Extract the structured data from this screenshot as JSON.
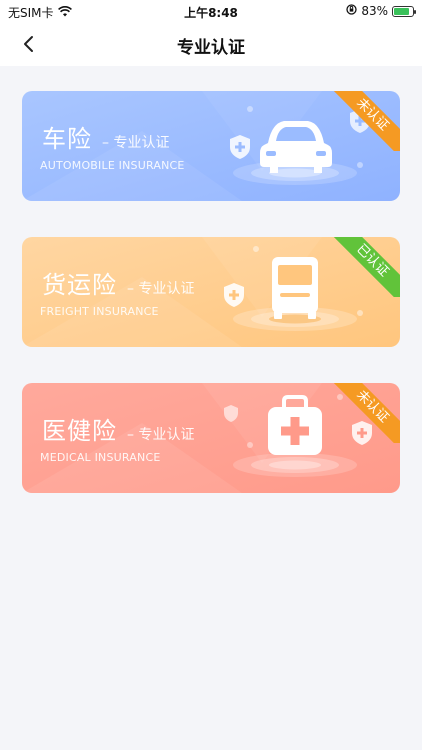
{
  "status_bar": {
    "carrier": "无SIM卡",
    "time": "上午8:48",
    "battery": "83%",
    "battery_level": 0.83
  },
  "nav": {
    "title": "专业认证"
  },
  "cards": [
    {
      "name": "车险",
      "subtitle": "– 专业认证",
      "english": "AUTOMOBILE INSURANCE",
      "status": "未认证",
      "status_color": "#f59a23",
      "gradient_from": "#a9c6ff",
      "gradient_to": "#8fb2ff",
      "icon": "car-icon"
    },
    {
      "name": "货运险",
      "subtitle": "– 专业认证",
      "english": "FREIGHT INSURANCE",
      "status": "已认证",
      "status_color": "#61c33a",
      "gradient_from": "#ffd6a2",
      "gradient_to": "#ffc67e",
      "icon": "truck-icon"
    },
    {
      "name": "医健险",
      "subtitle": "– 专业认证",
      "english": "MEDICAL INSURANCE",
      "status": "未认证",
      "status_color": "#f59a23",
      "gradient_from": "#ffa99c",
      "gradient_to": "#ff9a8a",
      "icon": "medical-kit-icon"
    }
  ]
}
